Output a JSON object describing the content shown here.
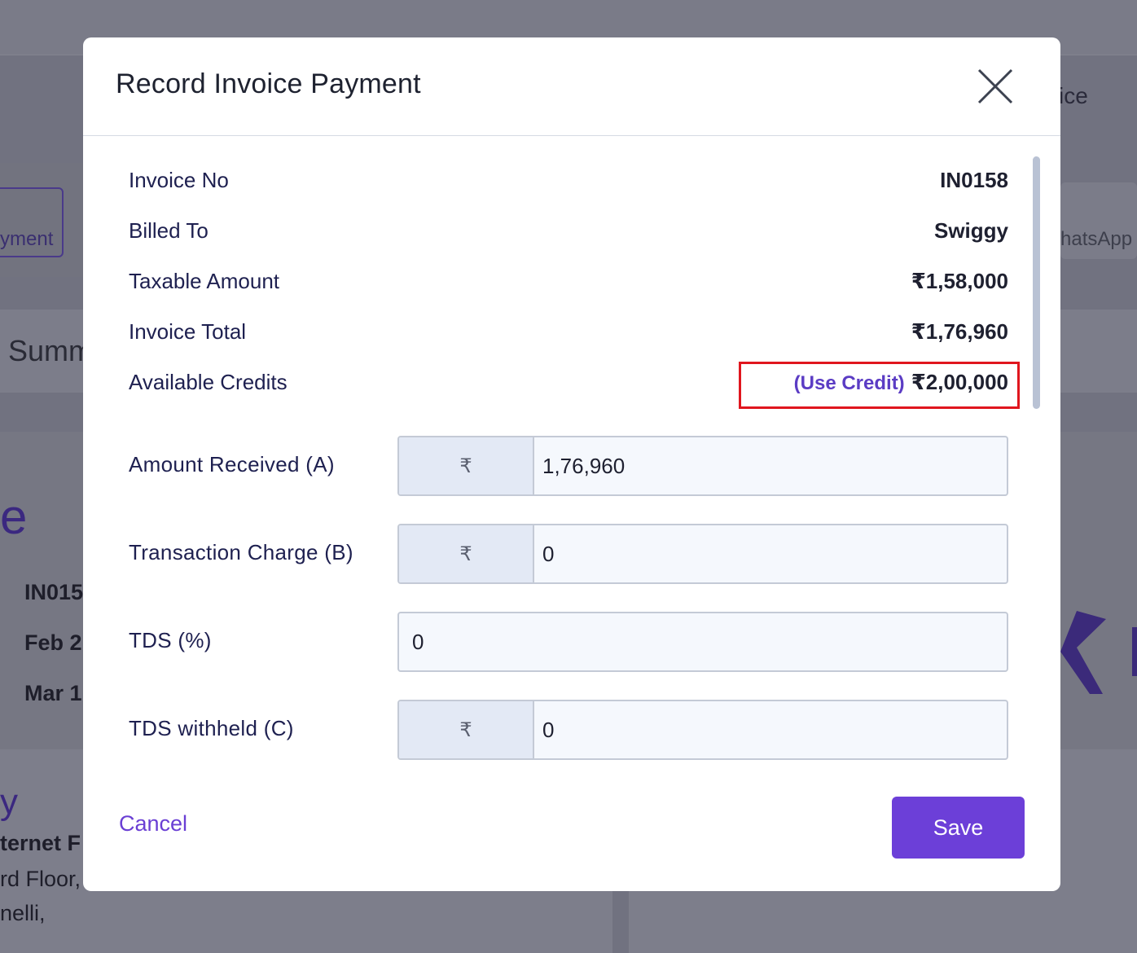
{
  "background": {
    "partial_texts": {
      "ice": "ice",
      "yment": "yment",
      "whatsapp": "hatsApp",
      "summ": "Summ",
      "e_heading": "e",
      "inv": "IN015",
      "feb": "Feb 2",
      "mar": "Mar 1",
      "y_heading": "y",
      "internet": "ternet F",
      "floor": "rd Floor,",
      "nelli": "nelli,"
    }
  },
  "modal": {
    "title": "Record Invoice Payment",
    "close_icon": "close-icon",
    "info": [
      {
        "label": "Invoice No",
        "value": "IN0158"
      },
      {
        "label": "Billed To",
        "value": "Swiggy"
      },
      {
        "label": "Taxable Amount",
        "value": "₹1,58,000"
      },
      {
        "label": "Invoice Total",
        "value": "₹1,76,960"
      }
    ],
    "credits": {
      "label": "Available Credits",
      "use_credit_link": "(Use Credit)",
      "value": "₹2,00,000"
    },
    "fields": {
      "amount_received": {
        "label": "Amount Received (A)",
        "prefix": "₹",
        "value": "1,76,960"
      },
      "transaction_charge": {
        "label": "Transaction Charge (B)",
        "prefix": "₹",
        "value": "0"
      },
      "tds_percent": {
        "label": "TDS (%)",
        "value": "0"
      },
      "tds_withheld": {
        "label": "TDS withheld (C)",
        "prefix": "₹",
        "value": "0"
      }
    },
    "footer": {
      "cancel_label": "Cancel",
      "save_label": "Save"
    }
  },
  "colors": {
    "accent": "#6c3fd8",
    "highlight_box": "#e0161e",
    "overlay": "#717280"
  }
}
